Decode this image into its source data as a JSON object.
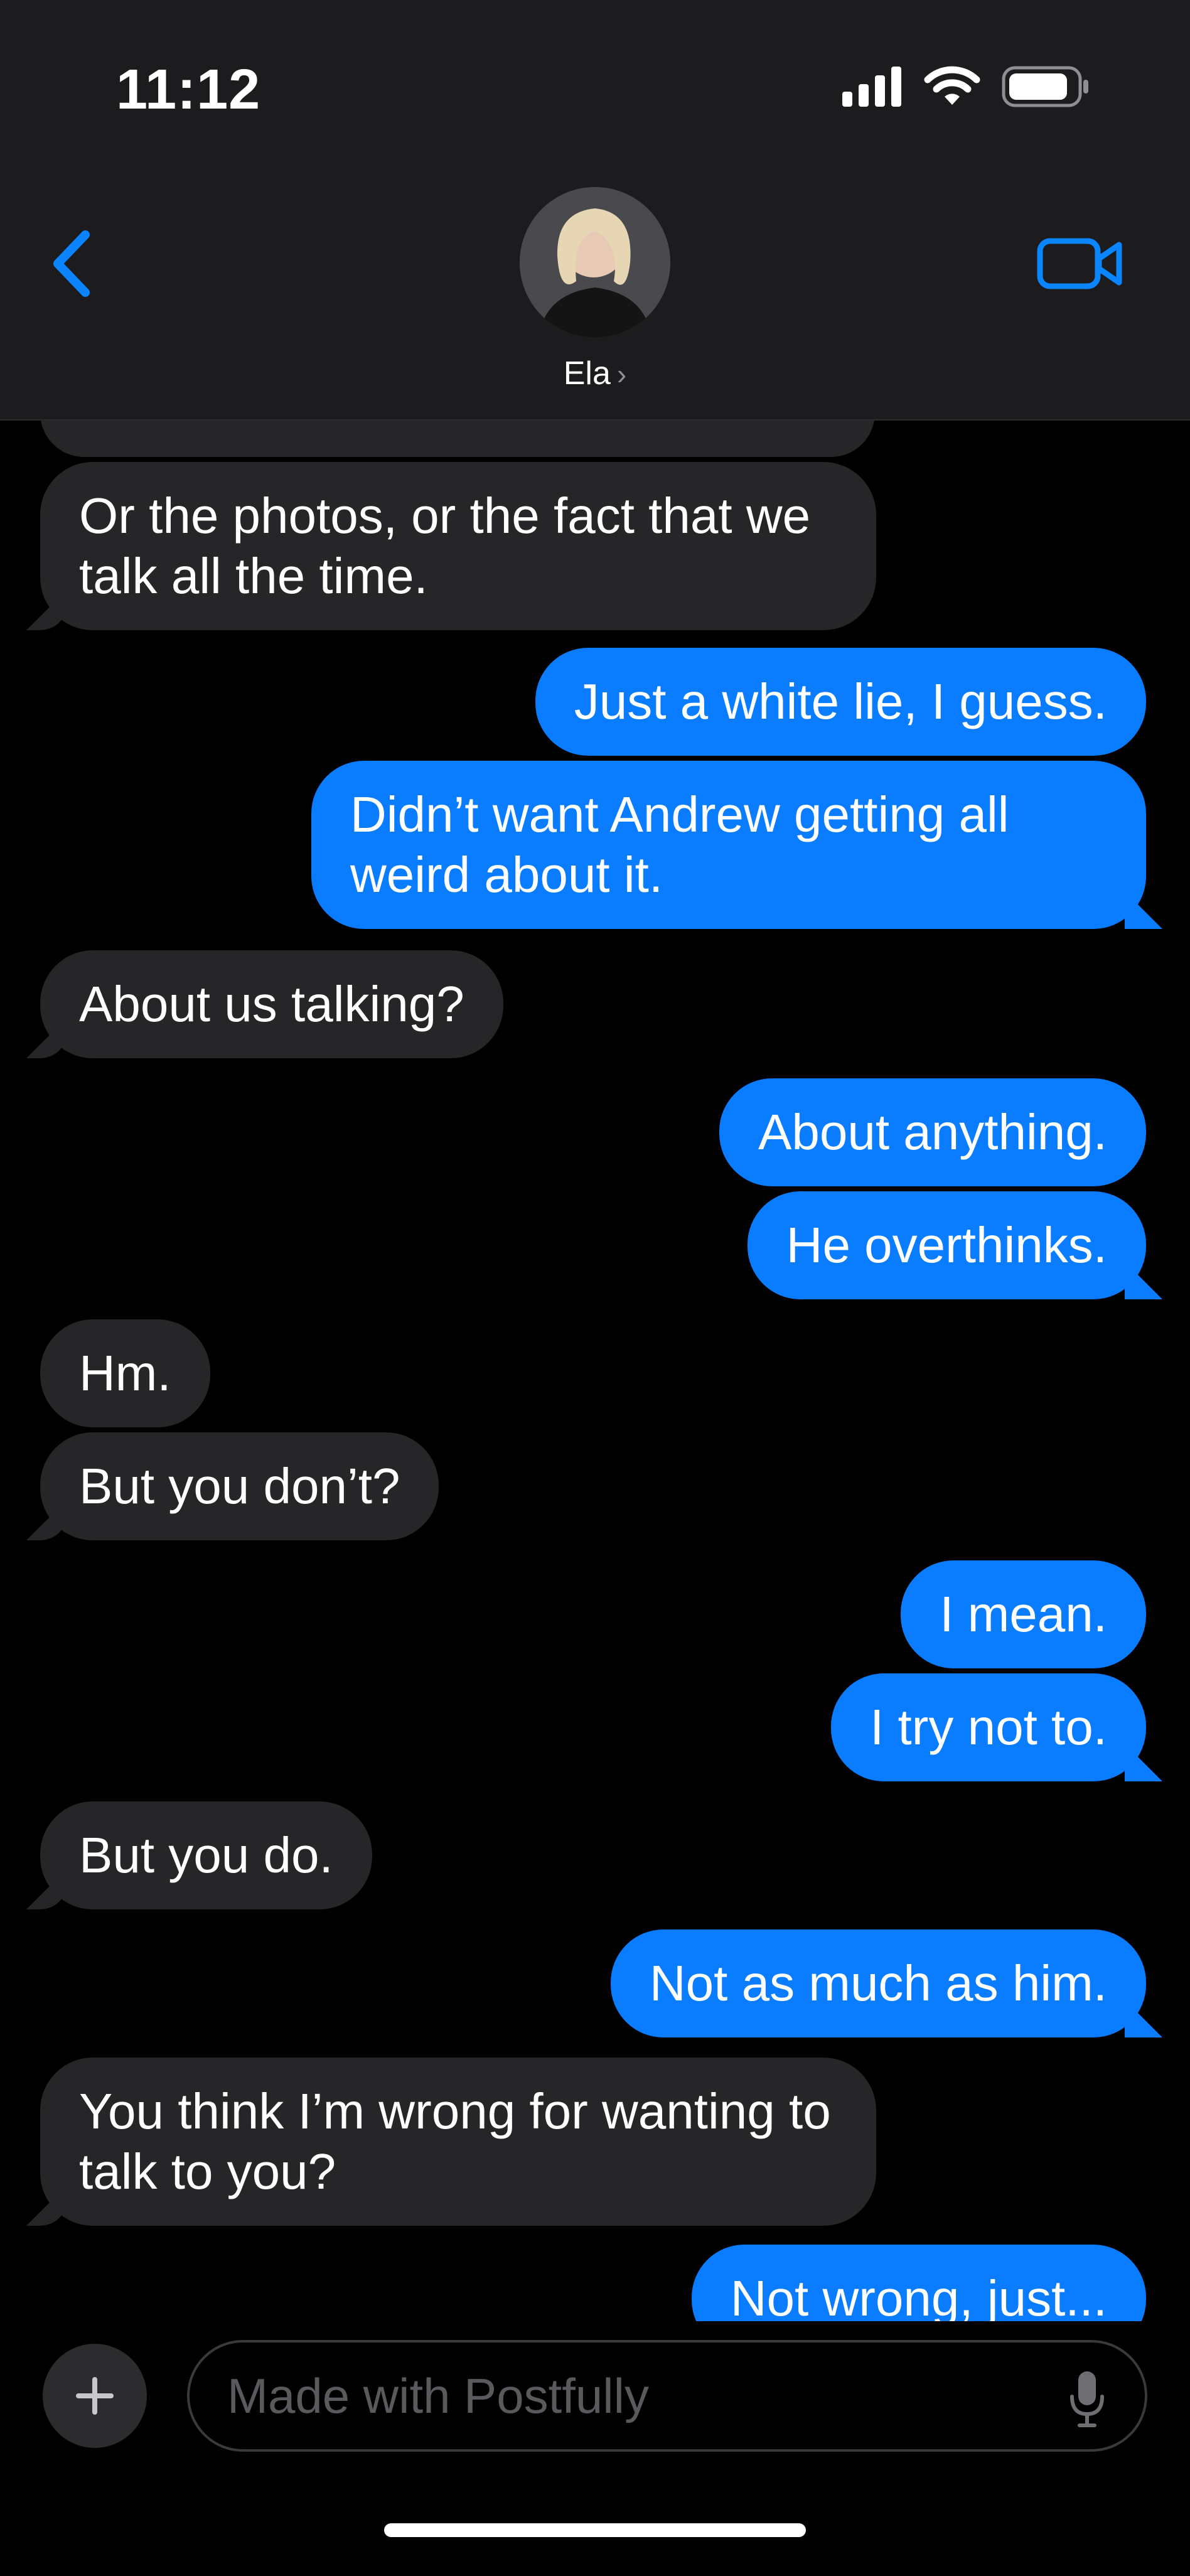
{
  "status_bar": {
    "time": "11:12"
  },
  "header": {
    "contact_name": "Ela",
    "chevron": "›"
  },
  "messages": [
    {
      "dir": "in",
      "text": ""
    },
    {
      "dir": "in",
      "text": "Or the photos, or the fact that we talk all the time."
    },
    {
      "dir": "out",
      "text": "Just a white lie, I guess."
    },
    {
      "dir": "out",
      "text": "Didn’t want Andrew getting all weird about it."
    },
    {
      "dir": "in",
      "text": "About us talking?"
    },
    {
      "dir": "out",
      "text": "About anything."
    },
    {
      "dir": "out",
      "text": "He overthinks."
    },
    {
      "dir": "in",
      "text": "Hm."
    },
    {
      "dir": "in",
      "text": "But you don’t?"
    },
    {
      "dir": "out",
      "text": "I mean."
    },
    {
      "dir": "out",
      "text": "I try not to."
    },
    {
      "dir": "in",
      "text": "But you do."
    },
    {
      "dir": "out",
      "text": "Not as much as him."
    },
    {
      "dir": "in",
      "text": "You think I’m wrong for wanting to talk to you?"
    },
    {
      "dir": "out",
      "text": "Not wrong, just..."
    }
  ],
  "composer": {
    "placeholder": "Made with Postfully"
  },
  "colors": {
    "outgoing": "#0a7cff",
    "incoming": "#262628",
    "accent": "#0a84ff"
  },
  "icons": {
    "back": "chevron-left-icon",
    "video": "video-camera-icon",
    "add": "plus-icon",
    "mic": "microphone-icon",
    "signal": "cellular-signal-icon",
    "wifi": "wifi-icon",
    "battery": "battery-icon"
  }
}
